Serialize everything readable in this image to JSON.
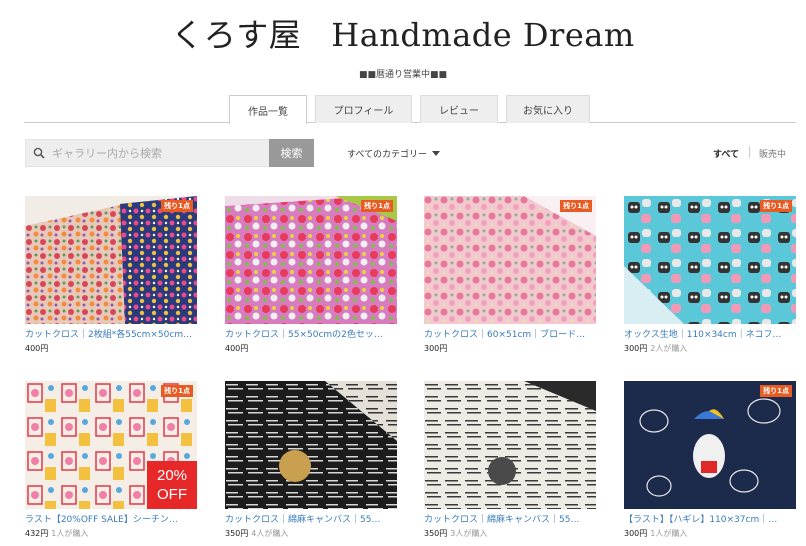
{
  "shop": {
    "name_jp": "くろす屋",
    "name_en": "Handmade Dream",
    "status": "■■暦通り営業中■■"
  },
  "tabs": [
    {
      "label": "作品一覧",
      "active": true
    },
    {
      "label": "プロフィール"
    },
    {
      "label": "レビュー"
    },
    {
      "label": "お気に入り"
    }
  ],
  "search": {
    "placeholder": "ギャラリー内から検索",
    "button": "検索",
    "icon": "search-icon"
  },
  "category": {
    "label": "すべてのカテゴリー",
    "icon": "caret-down-icon"
  },
  "filters": {
    "all": "すべて",
    "on_sale": "販売中"
  },
  "colors": {
    "badge": "#e85c24",
    "sale": "#e62828",
    "link": "#3a7bbd",
    "search_btn": "#999999"
  },
  "items": [
    {
      "title": "カットクロス｜2枚組*各55cm×50cm…",
      "price": "400円",
      "buyers": "",
      "badge": "残り1点"
    },
    {
      "title": "カットクロス｜55×50cmの2色セッ…",
      "price": "400円",
      "buyers": "",
      "badge": "残り1点"
    },
    {
      "title": "カットクロス｜60×51cm｜ブロード…",
      "price": "300円",
      "buyers": "",
      "badge": "残り1点"
    },
    {
      "title": "オックス生地｜110×34cm｜ネコフ…",
      "price": "300円",
      "buyers": "2人が購入",
      "badge": "残り1点"
    },
    {
      "title": "ラスト【20%OFF SALE】シーチン…",
      "price": "432円",
      "buyers": "1人が購入",
      "badge": "残り1点",
      "sale_line1": "20%",
      "sale_line2": "OFF"
    },
    {
      "title": "カットクロス｜綿麻キャンバス｜55…",
      "price": "350円",
      "buyers": "4人が購入",
      "badge": ""
    },
    {
      "title": "カットクロス｜綿麻キャンバス｜55…",
      "price": "350円",
      "buyers": "3人が購入",
      "badge": ""
    },
    {
      "title": "【ラスト】【ハギレ】110×37cm｜…",
      "price": "300円",
      "buyers": "1人が購入",
      "badge": "残り1点"
    }
  ]
}
